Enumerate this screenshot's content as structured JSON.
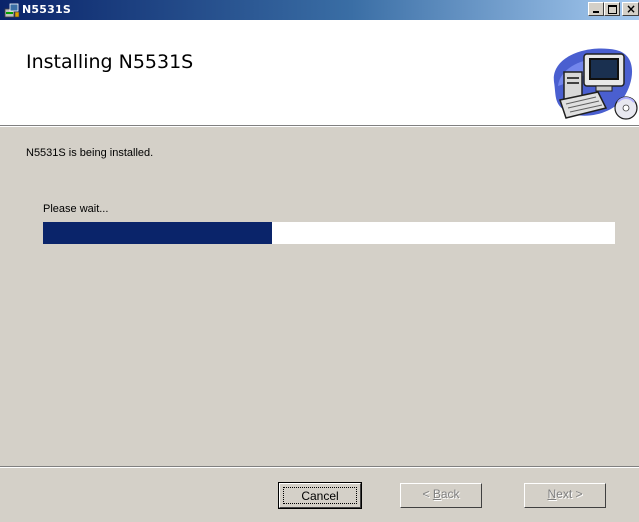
{
  "window": {
    "title": "N5531S",
    "controls": [
      "minimize-icon",
      "maximize-icon",
      "close-icon"
    ],
    "title_bar_colors": [
      "#0a246a",
      "#a6caf0"
    ]
  },
  "header": {
    "title": "Installing N5531S",
    "art_icon": "computer-installer-icon"
  },
  "main": {
    "status_text": "N5531S is being installed.",
    "wait_text": "Please wait...",
    "progress_fraction": 0.4,
    "progress_color": "#0a246a"
  },
  "footer": {
    "cancel_label": "Cancel",
    "back_prefix": "< ",
    "back_accel": "B",
    "back_rest": "ack",
    "next_accel": "N",
    "next_rest": "ext >"
  }
}
